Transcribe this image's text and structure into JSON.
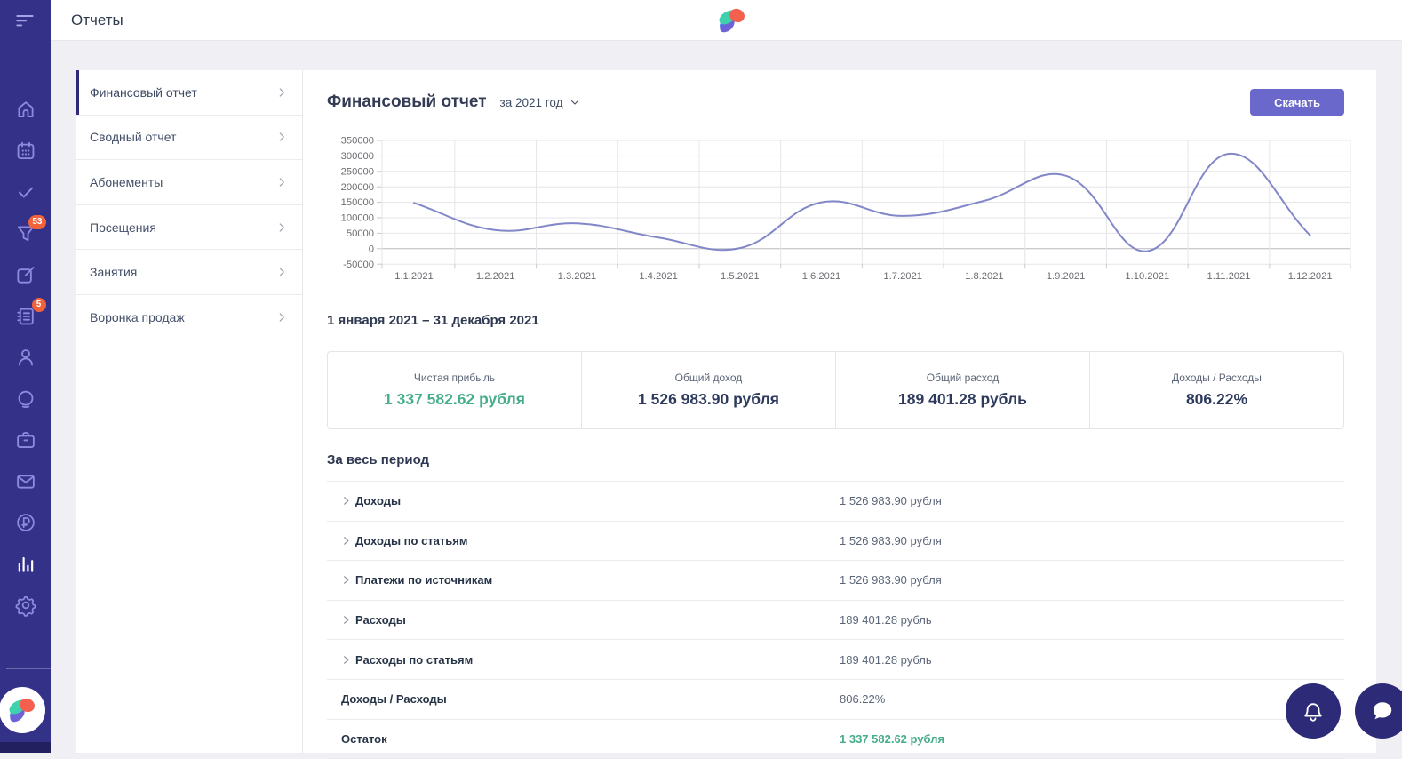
{
  "app": {
    "title": "Отчеты"
  },
  "sidebar": {
    "icons": [
      "home",
      "calendar",
      "check",
      "filter",
      "compose",
      "notebook",
      "user",
      "face",
      "briefcase",
      "mail",
      "ruble",
      "stats",
      "settings"
    ],
    "active_icon": "stats",
    "badges": {
      "filter": "53",
      "notebook": "5"
    }
  },
  "menu": {
    "items": [
      {
        "label": "Финансовый отчет",
        "active": true
      },
      {
        "label": "Сводный отчет",
        "active": false
      },
      {
        "label": "Абонементы",
        "active": false
      },
      {
        "label": "Посещения",
        "active": false
      },
      {
        "label": "Занятия",
        "active": false
      },
      {
        "label": "Воронка продаж",
        "active": false
      }
    ]
  },
  "report": {
    "title": "Финансовый отчет",
    "period_selector": "за 2021 год",
    "download_label": "Скачать",
    "date_range_heading": "1 января 2021 – 31 декабря 2021",
    "summary_cards": [
      {
        "label": "Чистая прибыль",
        "value": "1 337 582.62 рубля",
        "highlight": "green"
      },
      {
        "label": "Общий доход",
        "value": "1 526 983.90 рубля",
        "highlight": "none"
      },
      {
        "label": "Общий расход",
        "value": "189 401.28 рубль",
        "highlight": "none"
      },
      {
        "label": "Доходы / Расходы",
        "value": "806.22%",
        "highlight": "none"
      }
    ],
    "section_heading": "За весь период",
    "rows": [
      {
        "label": "Доходы",
        "value": "1 526 983.90 рубля",
        "expandable": true,
        "highlight": "none"
      },
      {
        "label": "Доходы по статьям",
        "value": "1 526 983.90 рубля",
        "expandable": true,
        "highlight": "none"
      },
      {
        "label": "Платежи по источникам",
        "value": "1 526 983.90 рубля",
        "expandable": true,
        "highlight": "none"
      },
      {
        "label": "Расходы",
        "value": "189 401.28 рубль",
        "expandable": true,
        "highlight": "none"
      },
      {
        "label": "Расходы по статьям",
        "value": "189 401.28 рубль",
        "expandable": true,
        "highlight": "none"
      },
      {
        "label": "Доходы / Расходы",
        "value": "806.22%",
        "expandable": false,
        "highlight": "none"
      },
      {
        "label": "Остаток",
        "value": "1 337 582.62 рубля",
        "expandable": false,
        "highlight": "green"
      }
    ]
  },
  "chart_data": {
    "type": "line",
    "x": [
      "1.1.2021",
      "1.2.2021",
      "1.3.2021",
      "1.4.2021",
      "1.5.2021",
      "1.6.2021",
      "1.7.2021",
      "1.8.2021",
      "1.9.2021",
      "1.10.2021",
      "1.11.2021",
      "1.12.2021"
    ],
    "series": [
      {
        "name": "Финансовый отчет",
        "values": [
          148000,
          60000,
          82000,
          36000,
          2000,
          150000,
          106000,
          155000,
          236000,
          -8000,
          307000,
          43000
        ]
      }
    ],
    "ylim": [
      -50000,
      350000
    ],
    "y_tick_step": 50000,
    "grid": true,
    "smooth": true,
    "line_color": "#8287c8",
    "legend": "none"
  },
  "colors": {
    "sidebar_bg": "#343189",
    "sidebar_icon": "#8e8ade",
    "badge": "#f2633c",
    "accent_purple": "#6b68cb",
    "accent_dark_indigo": "#2d2a78",
    "positive_green": "#45ad89"
  }
}
